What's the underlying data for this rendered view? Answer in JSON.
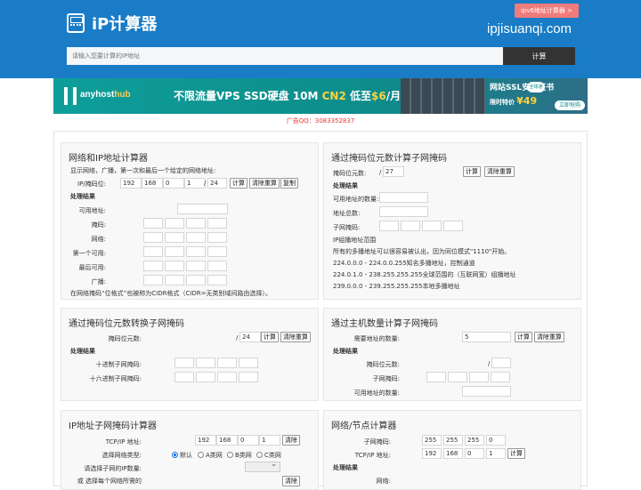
{
  "header": {
    "logo_text": "iP计算器",
    "ipv6_button": "ipv6地址计算器 >",
    "domain": "ipjisuanqi.com",
    "search_placeholder": "请输入您要计算的IP地址",
    "search_button": "计算"
  },
  "banner": {
    "brand_a": "anyhost",
    "brand_b": "hub",
    "text_a": "不限流量VPS SSD硬盘 10M ",
    "text_cn2": "CN2",
    "text_b": " 低至",
    "price": "$6",
    "text_c": "/月",
    "ssl_title": "网站SSL安全证书",
    "ssl_price_label": "限时特价",
    "ssl_price": "¥49",
    "ssl_tag": "全球通",
    "ssl_buy": "立即抢购"
  },
  "ad_line": "广告QQ：3083352837",
  "common": {
    "calc": "计算",
    "reset": "清除重算",
    "copy": "复制",
    "result_heading": "处理结果",
    "clear": "清除"
  },
  "p1": {
    "title": "网络和IP地址计算器",
    "desc": "显示网络，广播，第一次和最后一个给定的网络地址:",
    "ip_label": "IP/掩码位:",
    "ip": [
      "192",
      "168",
      "0",
      "1"
    ],
    "prefix": "24",
    "labels": [
      "可用地址:",
      "掩码:",
      "网络:",
      "第一个可用:",
      "最后可用:",
      "广播:"
    ],
    "footer": "在网络掩码“位格式”也被称为CIDR格式（CIDR=无类别域间路由选择）。"
  },
  "p2": {
    "title": "通过掩码位元数计算子网掩码",
    "bits_label": "掩码位元数:",
    "slash": "/",
    "bits": "27",
    "labels": [
      "可用地址的数量:",
      "地址总数:",
      "子网掩码:"
    ],
    "range_title": "IP组播地址范围",
    "lines": [
      "所有的多播地址可以很容易被认出，因为同位模式\"1110\"开始。",
      "224.0.0.0 - 224.0.0.255知名多播地址，控制通道",
      "224.0.1.0 - 238.255.255.255全球范围的（互联网宽）组播地址",
      "239.0.0.0 - 239.255.255.255本地多播地址"
    ]
  },
  "p3": {
    "title": "通过掩码位元数转换子网掩码",
    "bits_label": "掩码位元数:",
    "slash": "/",
    "bits": "24",
    "labels": [
      "十进制子网掩码:",
      "十六进制子网掩码:"
    ]
  },
  "p4": {
    "title": "通过主机数量计算子网掩码",
    "need_label": "需要地址的数量:",
    "need": "5",
    "labels": [
      "掩码位元数:",
      "子网掩码:",
      "可用地址的数量:"
    ],
    "slash": "/"
  },
  "p5": {
    "title": "IP地址子网掩码计算器",
    "ip_label": "TCP/IP 地址:",
    "ip": [
      "192",
      "168",
      "0",
      "1"
    ],
    "type_label": "选择网络类型:",
    "types": [
      "默认",
      "A类网",
      "B类网",
      "C类网"
    ],
    "count_label": "请选择子网的IP数量:",
    "cut_label": "或 选择每个网络所需的"
  },
  "p6": {
    "title": "网络/节点计算器",
    "mask_label": "子网掩码:",
    "mask": [
      "255",
      "255",
      "255",
      "0"
    ],
    "ip_label": "TCP/IP 地址:",
    "ip": [
      "192",
      "168",
      "0",
      "1"
    ],
    "net_label": "网络:"
  }
}
